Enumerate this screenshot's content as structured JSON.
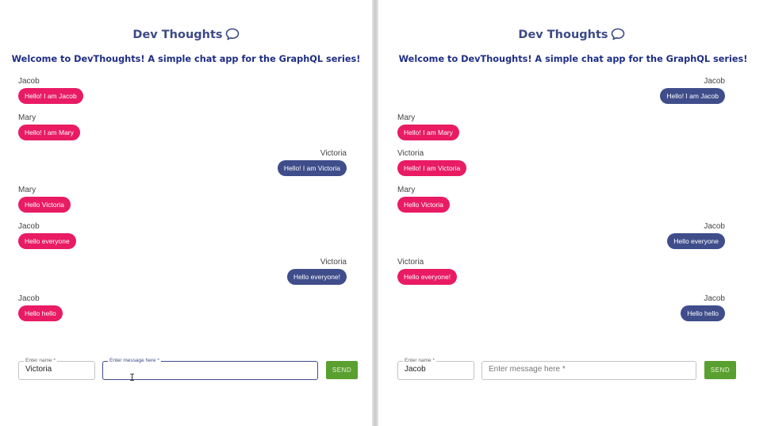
{
  "left_window": {
    "title": "Dev Thoughts",
    "welcome": "Welcome to DevThoughts! A simple chat app for the GraphQL series!",
    "messages": [
      {
        "user": "Jacob",
        "text": "Hello! I am Jacob"
      },
      {
        "user": "Mary",
        "text": "Hello! I am Mary"
      },
      {
        "user": "Victoria",
        "text": "Hello! I am Victoria"
      },
      {
        "user": "Mary",
        "text": "Hello Victoria"
      },
      {
        "user": "Jacob",
        "text": "Hello everyone"
      },
      {
        "user": "Victoria",
        "text": "Hello everyone!"
      },
      {
        "user": "Jacob",
        "text": "Hello hello"
      }
    ],
    "name_label": "Enter name *",
    "name_value": "Victoria",
    "message_label": "Enter message here *",
    "message_value": "",
    "send_label": "SEND"
  },
  "right_window": {
    "title": "Dev Thoughts",
    "welcome": "Welcome to DevThoughts! A simple chat app for the GraphQL series!",
    "messages": [
      {
        "user": "Jacob",
        "text": "Hello! I am Jacob"
      },
      {
        "user": "Mary",
        "text": "Hello! I am Mary"
      },
      {
        "user": "Victoria",
        "text": "Hello! I am Victoria"
      },
      {
        "user": "Mary",
        "text": "Hello Victoria"
      },
      {
        "user": "Jacob",
        "text": "Hello everyone"
      },
      {
        "user": "Victoria",
        "text": "Hello everyone!"
      },
      {
        "user": "Jacob",
        "text": "Hello hello"
      }
    ],
    "name_label": "Enter name *",
    "name_value": "Jacob",
    "message_placeholder": "Enter message here *",
    "send_label": "SEND"
  },
  "colors": {
    "own_bubble": "#3f4d8b",
    "other_bubble": "#e81b63",
    "title": "#3c4a85",
    "send_button": "#59a030"
  },
  "icons": [
    "chat-bubble-icon",
    "text-cursor-icon"
  ]
}
